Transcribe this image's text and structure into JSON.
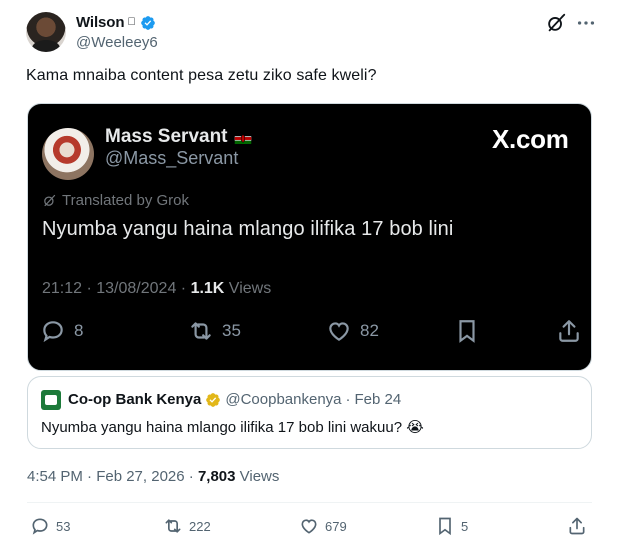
{
  "author": {
    "name": "Wilson",
    "name_suffix_icon": "apple-icon",
    "handle": "@Weeleey6",
    "verified": true
  },
  "tweet": {
    "text": "Kama mnaiba content pesa zetu ziko safe kweli?",
    "timestamp": "4:54 PM · Feb 27, 2026 · ",
    "views_count": "7,803",
    "views_label": " Views"
  },
  "media": {
    "name": "Mass Servant",
    "flag": "kenya-flag-icon",
    "handle": "@Mass_Servant",
    "brand": "X.com",
    "translated_label": "Translated by Grok",
    "text": "Nyumba yangu haina mlango ilifika 17 bob lini",
    "meta": "21:12 · 13/08/2024 · ",
    "views_count": "1.1K",
    "views_label": " Views",
    "replies": "8",
    "reposts": "35",
    "likes": "82"
  },
  "quote": {
    "name": "Co-op Bank Kenya",
    "handle": "@Coopbankenya",
    "separator": "·",
    "date": "Feb 24",
    "text": "Nyumba yangu haina mlango ilifika 17 bob lini wakuu? 😭"
  },
  "actions": {
    "replies": "53",
    "reposts": "222",
    "likes": "679",
    "bookmarks": "5"
  },
  "colors": {
    "verified_blue": "#1d9bf0",
    "gold_badge": "#e2b719",
    "coop_green": "#1d7a3a",
    "secondary_text": "#536471"
  }
}
